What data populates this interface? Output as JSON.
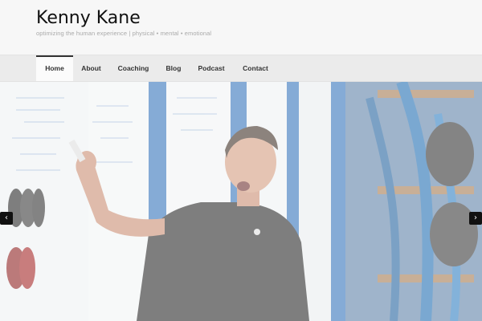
{
  "site": {
    "title": "Kenny Kane",
    "tagline": "optimizing the human experience | physical • mental • emotional"
  },
  "nav": {
    "items": [
      {
        "label": "Home",
        "active": true
      },
      {
        "label": "About"
      },
      {
        "label": "Coaching"
      },
      {
        "label": "Blog"
      },
      {
        "label": "Podcast"
      },
      {
        "label": "Contact"
      }
    ]
  },
  "slider": {
    "prev_icon": "‹",
    "next_icon": "›"
  }
}
